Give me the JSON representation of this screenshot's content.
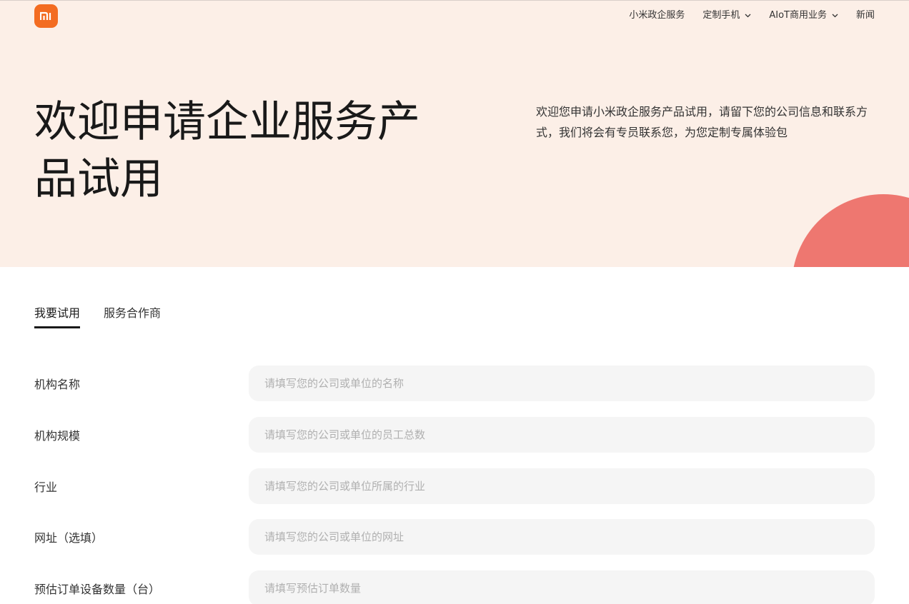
{
  "brand": {
    "logo_icon": "mi-logo-icon",
    "logo_color": "#f36c21"
  },
  "nav": {
    "items": [
      {
        "label": "小米政企服务",
        "has_dropdown": false
      },
      {
        "label": "定制手机",
        "has_dropdown": true
      },
      {
        "label": "AIoT商用业务",
        "has_dropdown": true
      },
      {
        "label": "新闻",
        "has_dropdown": false
      }
    ]
  },
  "hero": {
    "title": "欢迎申请企业服务产品试用",
    "description": "欢迎您申请小米政企服务产品试用，请留下您的公司信息和联系方式，我们将会有专员联系您，为您定制专属体验包",
    "background": "#fcefe7",
    "circle_color": "#ee7770"
  },
  "tabs": [
    {
      "label": "我要试用",
      "active": true
    },
    {
      "label": "服务合作商",
      "active": false
    }
  ],
  "form": {
    "fields": [
      {
        "label": "机构名称",
        "placeholder": "请填写您的公司或单位的名称",
        "value": ""
      },
      {
        "label": "机构规模",
        "placeholder": "请填写您的公司或单位的员工总数",
        "value": ""
      },
      {
        "label": "行业",
        "placeholder": "请填写您的公司或单位所属的行业",
        "value": ""
      },
      {
        "label": "网址（选填）",
        "placeholder": "请填写您的公司或单位的网址",
        "value": ""
      },
      {
        "label": "预估订单设备数量（台）",
        "placeholder": "请填写预估订单数量",
        "value": ""
      }
    ]
  }
}
